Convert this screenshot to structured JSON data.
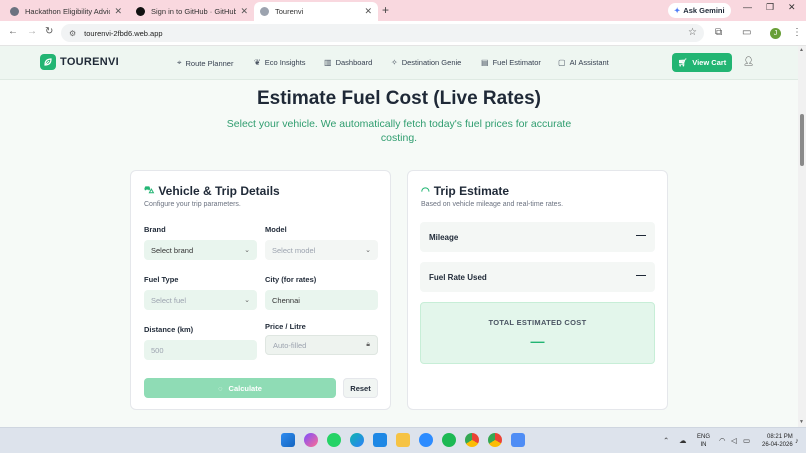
{
  "browser": {
    "tabs": [
      {
        "label": "Hackathon Eligibility Advice",
        "active": false
      },
      {
        "label": "Sign in to GitHub · GitHub",
        "active": false
      },
      {
        "label": "Tourenvi",
        "active": true
      }
    ],
    "ask_gemini": "Ask Gemini",
    "url": "tourenvi-2fbd6.web.app",
    "profile_initial": "J"
  },
  "site": {
    "logo": "TOURENVI",
    "nav": [
      {
        "label": "Route Planner",
        "icon": "map-pin-icon"
      },
      {
        "label": "Eco Insights",
        "icon": "leaf-icon"
      },
      {
        "label": "Dashboard",
        "icon": "bar-chart-icon"
      },
      {
        "label": "Destination Genie",
        "icon": "sparkles-icon"
      },
      {
        "label": "Fuel Estimator",
        "icon": "fuel-icon"
      },
      {
        "label": "AI Assistant",
        "icon": "chat-icon"
      }
    ],
    "cart_label": "View Cart",
    "accent": "#22b573"
  },
  "main": {
    "title": "Estimate Fuel Cost (Live Rates)",
    "subtitle": "Select your vehicle. We automatically fetch today's fuel prices for accurate costing."
  },
  "form": {
    "title": "Vehicle & Trip Details",
    "subtitle": "Configure your trip parameters.",
    "brand": {
      "label": "Brand",
      "value": "Select brand"
    },
    "model": {
      "label": "Model",
      "value": "Select model"
    },
    "fuel_type": {
      "label": "Fuel Type",
      "value": "Select fuel"
    },
    "city": {
      "label": "City (for rates)",
      "value": "Chennai"
    },
    "distance": {
      "label": "Distance (km)",
      "placeholder": "500"
    },
    "price": {
      "label": "Price / Litre",
      "placeholder": "Auto-filled"
    },
    "calculate_label": "Calculate",
    "reset_label": "Reset"
  },
  "estimate": {
    "title": "Trip Estimate",
    "subtitle": "Based on vehicle mileage and real-time rates.",
    "mileage": {
      "label": "Mileage",
      "value": "—"
    },
    "fuel_rate": {
      "label": "Fuel Rate Used",
      "value": "—"
    },
    "total": {
      "label": "TOTAL ESTIMATED COST",
      "value": "—"
    }
  },
  "taskbar": {
    "lang_line1": "ENG",
    "lang_line2": "IN",
    "time": "08:21 PM",
    "date": "26-04-2026"
  }
}
